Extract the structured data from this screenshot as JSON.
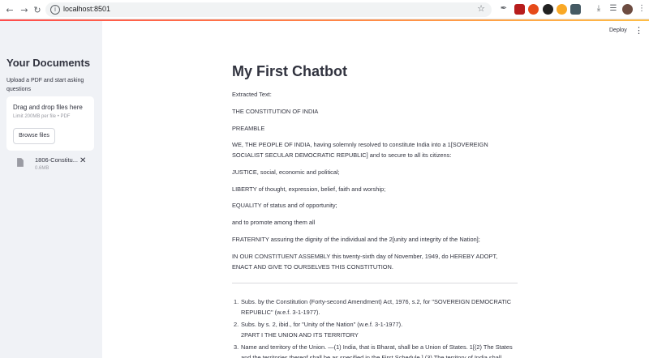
{
  "browser": {
    "url": "localhost:8501",
    "back_icon": "arrow-left-icon",
    "forward_icon": "arrow-right-icon",
    "reload_icon": "reload-icon"
  },
  "header": {
    "deploy_label": "Deploy"
  },
  "sidebar": {
    "title": "Your Documents",
    "description": "Upload a PDF and start asking questions",
    "uploader": {
      "drop_text": "Drag and drop files here",
      "limit_text": "Limit 200MB per file • PDF",
      "browse_label": "Browse files"
    },
    "file": {
      "name": "1806-Constitu...",
      "size": "0.6MB"
    }
  },
  "main": {
    "title": "My First Chatbot",
    "paragraphs": [
      "Extracted Text:",
      "THE CONSTITUTION OF INDIA",
      "PREAMBLE",
      "WE, THE PEOPLE OF INDIA, having solemnly resolved to constitute India into a 1[SOVEREIGN SOCIALIST SECULAR DEMOCRATIC REPUBLIC] and to secure to all its citizens:",
      "JUSTICE, social, economic and political;",
      "LIBERTY of thought, expression, belief, faith and worship;",
      "EQUALITY of status and of opportunity;",
      "and to promote among them all",
      "FRATERNITY assuring the dignity of the individual and the 2[unity and integrity of the Nation];",
      "IN OUR CONSTITUENT ASSEMBLY this twenty-sixth day of November, 1949, do HEREBY ADOPT, ENACT AND GIVE TO OURSELVES THIS CONSTITUTION."
    ],
    "footnotes": [
      {
        "num": "1.",
        "text": "Subs. by the Constitution (Forty-second Amendment) Act, 1976, s.2, for \"SOVEREIGN DEMOCRATIC REPUBLIC\" (w.e.f. 3-1-1977)."
      },
      {
        "num": "2.",
        "text": "Subs. by s. 2, ibid., for \"Unity of the Nation\" (w.e.f. 3-1-1977).",
        "text2": "2PART I THE UNION AND ITS TERRITORY"
      },
      {
        "num": "3.",
        "text": "Name and territory of the Union. —(1) India, that is Bharat, shall be a Union of States. 1[(2) The States and the territories thereof shall be as specified in the First Schedule.] (3) The territory of India shall"
      }
    ]
  },
  "colors": {
    "sidebar_bg": "#f0f2f6",
    "text": "#31333f",
    "accent_start": "#ff4b4b",
    "accent_end": "#ffbd45"
  }
}
